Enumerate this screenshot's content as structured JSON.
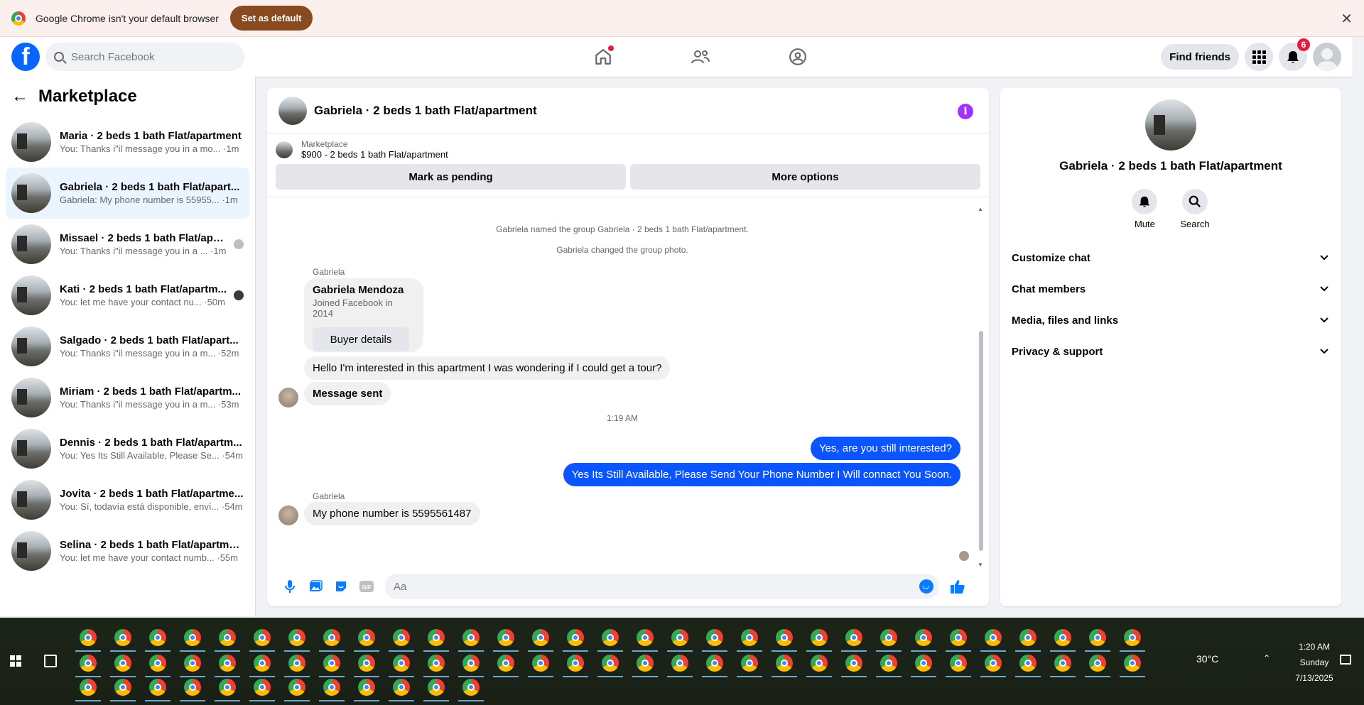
{
  "banner": {
    "message": "Google Chrome isn't your default browser",
    "set_default": "Set as default",
    "close": "✕"
  },
  "header": {
    "search_placeholder": "Search Facebook",
    "find_friends": "Find friends",
    "notifications_count": "6"
  },
  "sidebar": {
    "back": "←",
    "title": "Marketplace",
    "conversations": [
      {
        "name": "Maria · 2 beds 1 bath Flat/apartment",
        "preview": "You: Thanks i\"il message you in a mo... ·1m",
        "active": false,
        "seen": ""
      },
      {
        "name": "Gabriela · 2 beds 1 bath Flat/apart...",
        "preview": "Gabriela: My phone number is 55955... ·1m",
        "active": true,
        "seen": ""
      },
      {
        "name": "Missael · 2 beds 1 bath Flat/apar...",
        "preview": "You: Thanks i\"il message you in a ... ·1m",
        "active": false,
        "seen": "light"
      },
      {
        "name": "Kati · 2 beds 1 bath Flat/apartm...",
        "preview": "You: let me have your contact nu... ·50m",
        "active": false,
        "seen": "dark"
      },
      {
        "name": "Salgado · 2 beds 1 bath Flat/apart...",
        "preview": "You: Thanks i\"il message you in a m... ·52m",
        "active": false,
        "seen": ""
      },
      {
        "name": "Miriam · 2 beds 1 bath Flat/apartm...",
        "preview": "You: Thanks i\"il message you in a m... ·53m",
        "active": false,
        "seen": ""
      },
      {
        "name": "Dennis · 2 beds 1 bath Flat/apartm...",
        "preview": "You: Yes Its Still Available, Please Se... ·54m",
        "active": false,
        "seen": ""
      },
      {
        "name": "Jovita · 2 beds 1 bath Flat/apartme...",
        "preview": "You: Sí, todavía está disponible, enví... ·54m",
        "active": false,
        "seen": ""
      },
      {
        "name": "Selina · 2 beds 1 bath Flat/apartme...",
        "preview": "You: let me have your contact numb... ·55m",
        "active": false,
        "seen": ""
      }
    ]
  },
  "chat": {
    "title": "Gabriela · 2 beds 1 bath Flat/apartment",
    "info_icon": "i",
    "marketplace_label": "Marketplace",
    "listing": "$900 - 2 beds 1 bath Flat/apartment",
    "mark_pending": "Mark as pending",
    "more_options": "More options",
    "system_1": "Gabriela named the group Gabriela · 2 beds 1 bath Flat/apartment.",
    "system_2": "Gabriela changed the group photo.",
    "sender_1": "Gabriela",
    "card_name": "Gabriela Mendoza",
    "card_joined": "Joined Facebook in 2014",
    "card_button": "Buyer details",
    "msg_1": "Hello I'm interested in this apartment I was wondering if I could get a tour?",
    "msg_2": "Message sent",
    "time_1": "1:19 AM",
    "out_1": "Yes, are you still interested?",
    "out_2": "Yes Its Still Available, Please Send Your Phone Number I Will connact You Soon.",
    "sender_2": "Gabriela",
    "msg_3": "My phone number is 5595561487",
    "composer_placeholder": "Aa"
  },
  "infopanel": {
    "name": "Gabriela · 2 beds 1 bath Flat/apartment",
    "mute": "Mute",
    "search": "Search",
    "sections": [
      "Customize chat",
      "Chat members",
      "Media, files and links",
      "Privacy & support"
    ]
  },
  "taskbar": {
    "temperature": "30°C",
    "time": "1:20 AM",
    "day": "Sunday",
    "date": "7/13/2025"
  },
  "colors": {
    "accent": "#0866ff",
    "outgoing": "#0a55ff",
    "info": "#a033ff"
  }
}
